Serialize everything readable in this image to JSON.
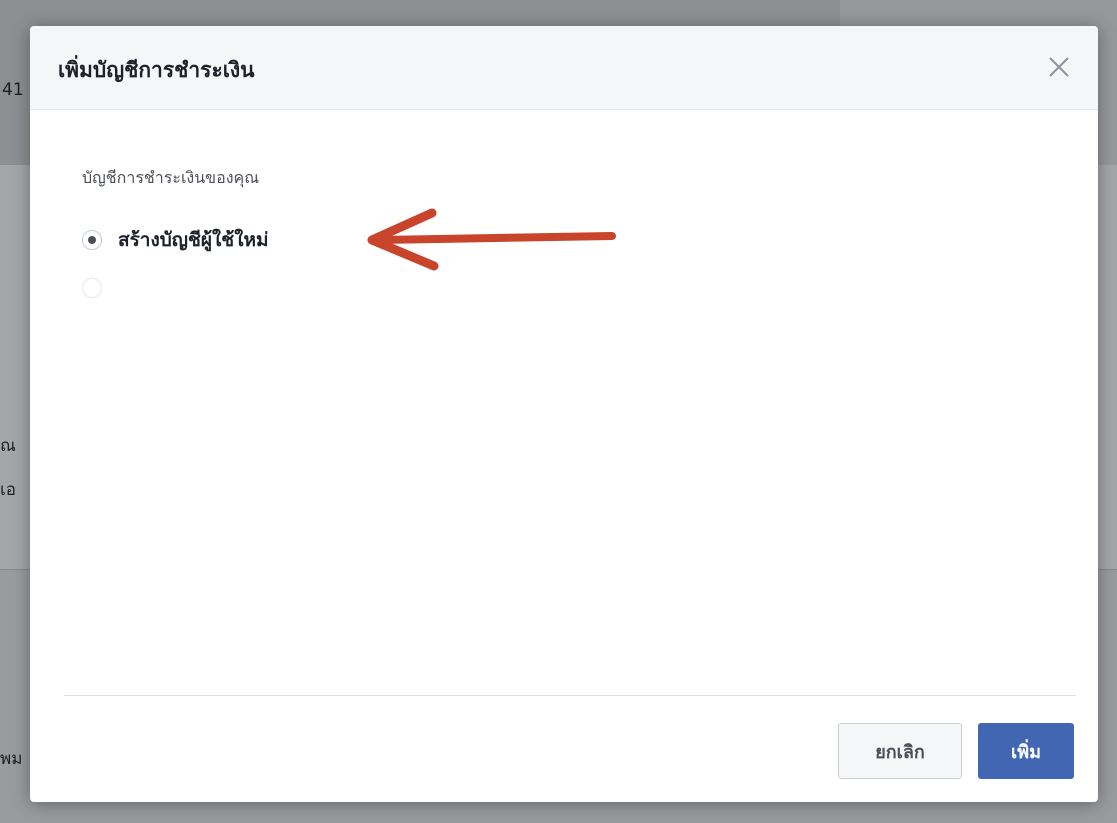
{
  "background": {
    "fragments": [
      "41",
      "ณ",
      "เอ",
      "พม"
    ]
  },
  "dialog": {
    "title": "เพิ่มบัญชีการชำระเงิน",
    "close_icon": "close-icon",
    "section_label": "บัญชีการชำระเงินของคุณ",
    "options": [
      {
        "label": "สร้างบัญชีผู้ใช้ใหม่",
        "selected": true,
        "enabled": true
      },
      {
        "label": "",
        "selected": false,
        "enabled": false
      }
    ],
    "buttons": {
      "cancel": "ยกเลิก",
      "add": "เพิ่ม"
    }
  },
  "annotation": {
    "type": "arrow",
    "color": "#c8452b"
  }
}
